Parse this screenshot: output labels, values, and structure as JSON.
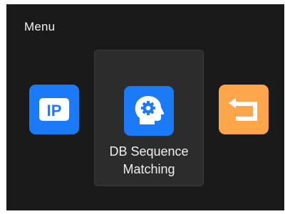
{
  "screen": {
    "title": "Menu"
  },
  "menu_items": [
    {
      "id": "ip",
      "icon": "ip-icon",
      "icon_text": "IP",
      "color": "#1a7af8",
      "selected": false
    },
    {
      "id": "db-sequence-matching",
      "icon": "head-gear-icon",
      "label": "DB Sequence\nMatching",
      "color": "#1a7af8",
      "selected": true
    },
    {
      "id": "back",
      "icon": "return-arrow-icon",
      "color": "#ffa64d",
      "selected": false
    }
  ],
  "colors": {
    "background": "#1a1a1a",
    "selected_card": "#2c2c2c",
    "accent_blue": "#1a7af8",
    "accent_orange": "#ffa64d"
  }
}
